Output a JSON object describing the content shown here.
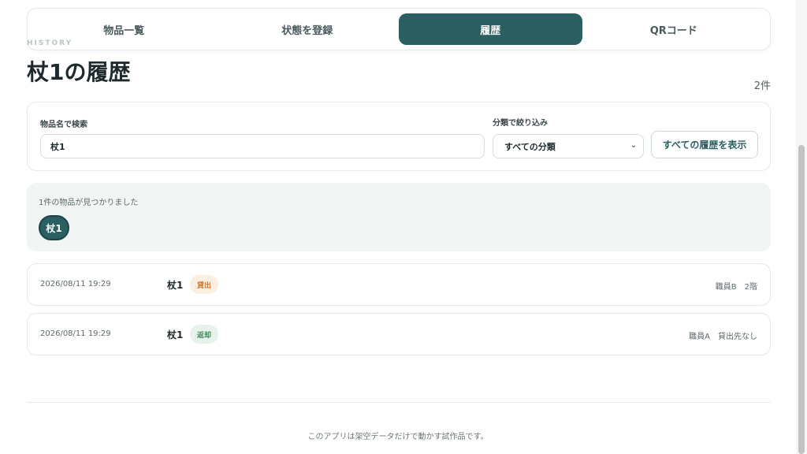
{
  "tabs": [
    {
      "label": "物品一覧",
      "active": false
    },
    {
      "label": "状態を登録",
      "active": false
    },
    {
      "label": "履歴",
      "active": true
    },
    {
      "label": "QRコード",
      "active": false
    }
  ],
  "header": {
    "eyebrow": "HISTORY",
    "title": "杖1の履歴",
    "count": "2件"
  },
  "filter": {
    "search_label": "物品名で検索",
    "search_value": "杖1",
    "category_label": "分類で絞り込み",
    "category_selected": "すべての分類",
    "show_all_label": "すべての履歴を表示"
  },
  "results": {
    "summary": "1件の物品が見つかりました",
    "items": [
      "杖1"
    ]
  },
  "history": [
    {
      "datetime": "2026/08/11 19:29",
      "item": "杖1",
      "status": "貸出",
      "status_type": "lend",
      "staff": "職員B",
      "location": "2階"
    },
    {
      "datetime": "2026/08/11 19:29",
      "item": "杖1",
      "status": "返却",
      "status_type": "return",
      "staff": "職員A",
      "location": "貸出先なし"
    }
  ],
  "footer": {
    "note": "このアプリは架空データだけで動かす試作品です。"
  },
  "colors": {
    "accent": "#2c5f61",
    "lend_badge": "#fbefe2",
    "return_badge": "#e6f2ea"
  }
}
